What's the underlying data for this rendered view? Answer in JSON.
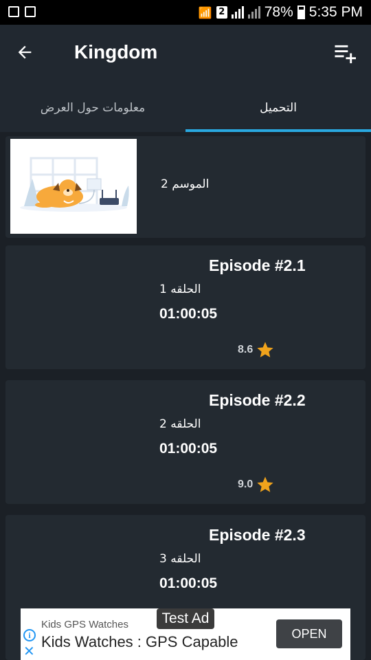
{
  "status_bar": {
    "sim_slot": "2",
    "battery": "78%",
    "time": "5:35 PM"
  },
  "toolbar": {
    "title": "Kingdom"
  },
  "tabs": [
    {
      "label": "معلومات حول العرض"
    },
    {
      "label": "التحميل"
    }
  ],
  "season": {
    "label": "الموسم 2"
  },
  "episodes": [
    {
      "title": "Episode #2.1",
      "number": "الحلقه 1",
      "duration": "01:00:05",
      "rating": "8.6"
    },
    {
      "title": "Episode #2.2",
      "number": "الحلقه 2",
      "duration": "01:00:05",
      "rating": "9.0"
    },
    {
      "title": "Episode #2.3",
      "number": "الحلقه 3",
      "duration": "01:00:05",
      "rating": ""
    }
  ],
  "ad": {
    "badge": "Test Ad",
    "small_text": "Kids GPS Watches",
    "big_text": "Kids Watches : GPS Capable",
    "button": "OPEN"
  },
  "colors": {
    "background": "#1b2026",
    "toolbar": "#212830",
    "card": "#232a31",
    "accent": "#29a8e0",
    "star": "#f0a31c"
  }
}
